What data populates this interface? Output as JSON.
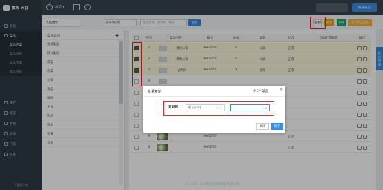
{
  "brand": {
    "name": "食店 天目"
  },
  "sidebar": {
    "items": [
      {
        "label": "首页"
      },
      {
        "label": "菜品"
      },
      {
        "label": "菜品档案"
      },
      {
        "label": "菜品口味"
      },
      {
        "label": "菜品沽清"
      },
      {
        "label": "做法管理"
      },
      {
        "label": "库存"
      },
      {
        "label": "报表"
      },
      {
        "label": "营销"
      },
      {
        "label": "会员"
      },
      {
        "label": "门店"
      },
      {
        "label": "设置"
      }
    ],
    "footer": "下载客户端"
  },
  "topbar": {
    "user": "总店 ▾",
    "right_btn1": "",
    "right_btn2": "快速开店"
  },
  "toolbar": {
    "tab_label": "菜品档案",
    "store_select": "请选择店铺",
    "search_placeholder": "菜品名称、拼音码、编号",
    "search_button": "搜索",
    "copy_button": "复制",
    "delete_button": "删除",
    "add_button": "新增",
    "print_button": "打印菜品标签"
  },
  "categories": {
    "header": "菜品类别",
    "add": "+",
    "items": [
      "全部菜品",
      "默认类别",
      "凉菜",
      "热菜",
      "火锅",
      "汤类",
      "海鲜",
      "主食",
      "饮品",
      "酒水",
      "套餐",
      "其他"
    ]
  },
  "table": {
    "headers": [
      "",
      "序号",
      "菜品名称",
      "编号",
      "价格",
      "类别",
      "状态",
      "默认打印标签",
      "操作"
    ],
    "rows": [
      {
        "no": "1",
        "name": "清汤火锅",
        "code": "4665779",
        "price": "5",
        "category": "火锅",
        "status": "正常",
        "selected": true,
        "image": "placeholder"
      },
      {
        "no": "2",
        "name": "鸳鸯火锅",
        "code": "4665778",
        "price": "5",
        "category": "火锅",
        "status": "正常",
        "selected": true,
        "image": "placeholder"
      },
      {
        "no": "3",
        "name": "卤鸭头",
        "code": "4665777",
        "price": "3",
        "category": "卤味",
        "status": "正常",
        "selected": true,
        "image": "placeholder"
      },
      {
        "no": "4",
        "name": "",
        "code": "",
        "price": "",
        "category": "",
        "status": "",
        "selected": false,
        "image": "placeholder"
      },
      {
        "no": "5",
        "name": "",
        "code": "",
        "price": "",
        "category": "",
        "status": "",
        "selected": false,
        "image": "placeholder"
      },
      {
        "no": "6",
        "name": "",
        "code": "",
        "price": "",
        "category": "",
        "status": "",
        "selected": false,
        "image": "placeholder"
      },
      {
        "no": "7",
        "name": "",
        "code": "",
        "price": "",
        "category": "",
        "status": "",
        "selected": false,
        "image": "placeholder"
      },
      {
        "no": "8",
        "name": "",
        "code": "",
        "price": "",
        "category": "",
        "status": "",
        "selected": false,
        "image": "photo"
      },
      {
        "no": "9",
        "name": "",
        "code": "4665730",
        "price": "",
        "category": "",
        "status": "正常",
        "selected": false,
        "image": "photo"
      },
      {
        "no": "0",
        "name": "",
        "code": "4665730",
        "price": "",
        "category": "",
        "status": "正常",
        "selected": false,
        "image": "photo"
      }
    ]
  },
  "float_tab": "在线客服",
  "modal": {
    "title": "批量复制",
    "count": "共3个菜品",
    "close": "×",
    "copy_to_label": "复制到",
    "source_store": "默认[ui0]",
    "target_store": "",
    "close_button": "关闭",
    "save_button": "保存"
  },
  "footer": "© 2017 · 深圳市思迅网络科技有限公司",
  "colors": {
    "accent": "#3a8ee6",
    "highlight": "#e8262c",
    "sidebar": "#2f3b45"
  }
}
